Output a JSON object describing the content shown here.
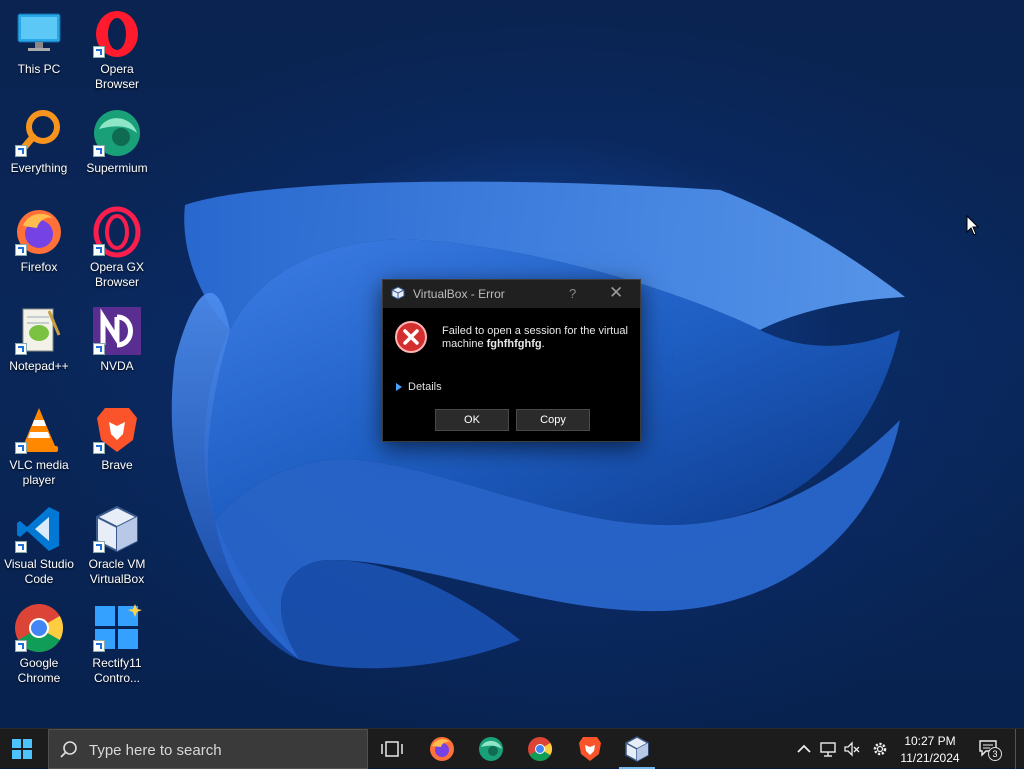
{
  "desktop": {
    "icons": [
      {
        "label": "This PC",
        "icon": "this-pc-icon"
      },
      {
        "label": "Opera Browser",
        "icon": "opera-icon"
      },
      {
        "label": "Everything",
        "icon": "everything-search-icon"
      },
      {
        "label": "Supermium",
        "icon": "supermium-icon"
      },
      {
        "label": "Firefox",
        "icon": "firefox-icon"
      },
      {
        "label": "Opera GX Browser",
        "icon": "opera-gx-icon"
      },
      {
        "label": "Notepad++",
        "icon": "notepad-plus-plus-icon"
      },
      {
        "label": "NVDA",
        "icon": "nvda-icon"
      },
      {
        "label": "VLC media player",
        "icon": "vlc-icon"
      },
      {
        "label": "Brave",
        "icon": "brave-icon"
      },
      {
        "label": "Visual Studio Code",
        "icon": "vscode-icon"
      },
      {
        "label": "Oracle VM VirtualBox",
        "icon": "virtualbox-icon"
      },
      {
        "label": "Google Chrome",
        "icon": "chrome-icon"
      },
      {
        "label": "Rectify11 Contro...",
        "icon": "rectify11-icon"
      }
    ]
  },
  "dialog": {
    "title": "VirtualBox - Error",
    "help_label": "?",
    "close_label": "✕",
    "message_prefix": "Failed to open a session for the virtual machine ",
    "vm_name": "fghfhfghfg",
    "message_suffix": ".",
    "details_label": "Details",
    "ok_label": "OK",
    "copy_label": "Copy"
  },
  "taskbar": {
    "search_placeholder": "Type here to search",
    "pinned_apps": [
      "task-view-icon",
      "firefox-icon",
      "supermium-icon",
      "chrome-icon",
      "brave-icon",
      "virtualbox-icon"
    ],
    "active_app": "virtualbox-icon",
    "time": "10:27 PM",
    "date": "11/21/2024",
    "notification_count": "3"
  },
  "colors": {
    "accent": "#76b9ed",
    "wallpaper_blue": "#1f5fc4",
    "error_red": "#d32f2f"
  }
}
